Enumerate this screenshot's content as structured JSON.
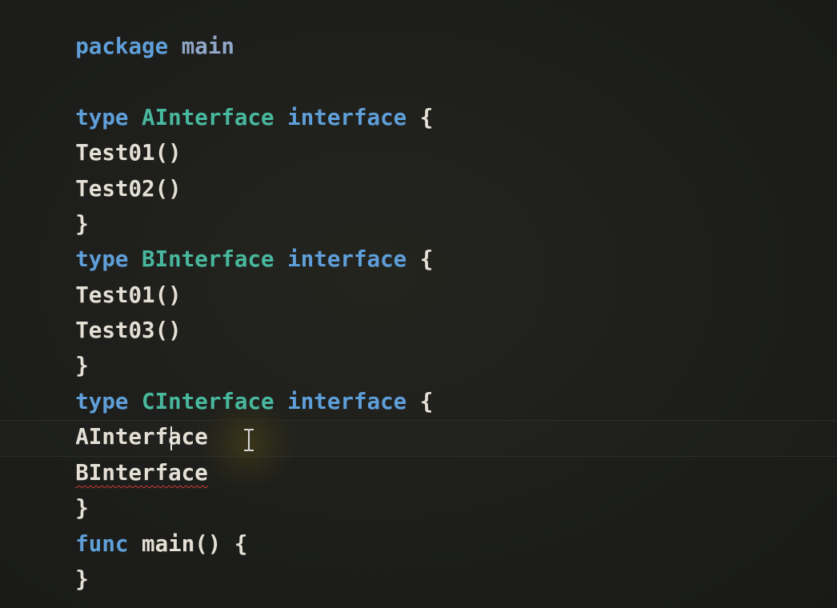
{
  "editor": {
    "language": "Go",
    "colors": {
      "background": "#1e1f1c",
      "keyword": "#5f9fd9",
      "type_name": "#48b89e",
      "text": "#e4e0d6",
      "error_squiggle": "#d03b3b"
    },
    "lines": [
      [
        "package",
        " main"
      ],
      [
        "type",
        " ",
        "AInterface",
        " ",
        "interface",
        " {"
      ],
      [
        "Test01()"
      ],
      [
        "Test02()"
      ],
      [
        "}"
      ],
      [
        "type",
        " ",
        "BInterface",
        " ",
        "interface",
        " {"
      ],
      [
        "Test01()"
      ],
      [
        "Test03()"
      ],
      [
        "}"
      ],
      [
        "type",
        " ",
        "CInterface",
        " ",
        "interface",
        " {"
      ],
      [
        "AInterface"
      ],
      [
        "BInterface"
      ],
      [
        "}"
      ],
      [
        "func",
        " main() {"
      ],
      [
        "}"
      ]
    ],
    "cursor": {
      "line": 12,
      "after_text": "BInterface"
    },
    "error_token": "BInterface"
  }
}
